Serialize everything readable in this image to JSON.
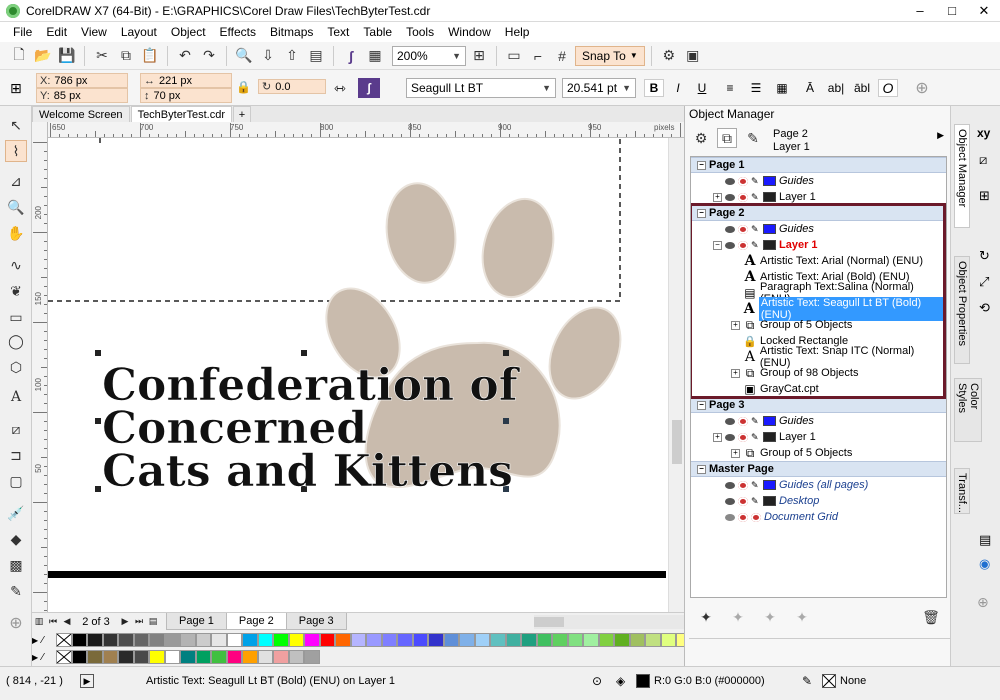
{
  "window": {
    "title": "CorelDRAW X7 (64-Bit) - E:\\GRAPHICS\\Corel Draw Files\\TechByterTest.cdr",
    "controls": [
      "–",
      "□",
      "✕"
    ]
  },
  "menu": [
    "File",
    "Edit",
    "View",
    "Layout",
    "Object",
    "Effects",
    "Bitmaps",
    "Text",
    "Table",
    "Tools",
    "Window",
    "Help"
  ],
  "toolbar": {
    "zoom": "200%",
    "snap_label": "Snap To"
  },
  "property_bar": {
    "x_label": "X:",
    "x_value": "786 px",
    "y_label": "Y:",
    "y_value": "85 px",
    "width_value": "221 px",
    "height_value": "70 px",
    "rotation_value": "0.0",
    "font_name": "Seagull Lt BT",
    "font_size": "20.541 pt",
    "font_style_glyph": "O"
  },
  "doc_tabs": [
    "Welcome Screen",
    "TechByterTest.cdr"
  ],
  "ruler": {
    "h_labels": [
      "650",
      "700",
      "750",
      "800",
      "850",
      "900",
      "950"
    ],
    "h_unit": "pixels",
    "v_labels": [
      "250",
      "200",
      "150",
      "100",
      "50"
    ]
  },
  "canvas": {
    "lines": [
      "Confederation of",
      "Concerned",
      "Cats and Kittens"
    ],
    "paw_color": "#c9bbad"
  },
  "page_nav": {
    "counter": "2 of 3",
    "tabs": [
      "Page 1",
      "Page 2",
      "Page 3"
    ],
    "active": "Page 2"
  },
  "palette": {
    "row1": [
      "#000000",
      "#1a1a1a",
      "#333333",
      "#4d4d4d",
      "#666666",
      "#808080",
      "#999999",
      "#b3b3b3",
      "#cccccc",
      "#e6e6e6",
      "#ffffff",
      "#00a2e8",
      "#00ffff",
      "#00ff00",
      "#ffff00",
      "#ff00ff",
      "#ff0000",
      "#ff6600",
      "#b5b5ff",
      "#9999ff",
      "#7f7fff",
      "#6666ff",
      "#4c4cff",
      "#3333cc",
      "#5f8fd8",
      "#7fb0e8",
      "#9fd0f8",
      "#60c0c0",
      "#40b0a0",
      "#20a080",
      "#40c060",
      "#60d060",
      "#80e080",
      "#a0f0a0",
      "#80d040",
      "#60b020",
      "#a0c060",
      "#c0e080",
      "#e0ff80",
      "#ffff80",
      "#ffe060",
      "#ffc040",
      "#ffa040",
      "#ff8040",
      "#ff6080",
      "#ff40a0",
      "#e040c0",
      "#c040e0",
      "#a060ff",
      "#8080ff"
    ],
    "row2": [
      "#000000",
      "#7a6a3a",
      "#a08050",
      "#2a2a2a",
      "#4a4a4a",
      "#ffff00",
      "#ffffff",
      "#008080",
      "#00a060",
      "#40c040",
      "#ff0080",
      "#ffa000",
      "#e0e0e0",
      "#f0a0a0",
      "#c0c0c0",
      "#a0a0a0"
    ]
  },
  "status": {
    "cursor": "( 814 , -21 )",
    "message": "Artistic Text: Seagull Lt BT (Bold) (ENU) on Layer 1",
    "fill_text": "R:0 G:0 B:0 (#000000)",
    "outline_text": "None"
  },
  "object_manager": {
    "title": "Object Manager",
    "header_page": "Page 2",
    "header_layer": "Layer 1",
    "rows": [
      {
        "label": "Page 1",
        "type": "page"
      },
      {
        "label": "Guides",
        "type": "guides",
        "color": "#1a1aff"
      },
      {
        "label": "Layer 1",
        "type": "layer",
        "color": "#222222"
      },
      {
        "label": "Page 2",
        "type": "page"
      },
      {
        "label": "Guides",
        "type": "guides",
        "color": "#1a1aff"
      },
      {
        "label": "Layer 1",
        "type": "layer-active",
        "color": "#222222"
      },
      {
        "label": "Artistic Text: Arial (Normal) (ENU)",
        "type": "text"
      },
      {
        "label": "Artistic Text: Arial (Bold) (ENU)",
        "type": "text"
      },
      {
        "label": "Paragraph Text:Salina (Normal) (ENU)",
        "type": "para"
      },
      {
        "label": "Artistic Text: Seagull Lt BT (Bold) (ENU)",
        "type": "text-selected"
      },
      {
        "label": "Group of 5 Objects",
        "type": "group"
      },
      {
        "label": "Locked Rectangle",
        "type": "lock"
      },
      {
        "label": "Artistic Text: Snap ITC (Normal) (ENU)",
        "type": "text-red"
      },
      {
        "label": "Group of 98 Objects",
        "type": "group"
      },
      {
        "label": "GrayCat.cpt",
        "type": "bitmap"
      },
      {
        "label": "Page 3",
        "type": "page"
      },
      {
        "label": "Guides",
        "type": "guides",
        "color": "#1a1aff"
      },
      {
        "label": "Layer 1",
        "type": "layer",
        "color": "#222222"
      },
      {
        "label": "Group of 5 Objects",
        "type": "group"
      },
      {
        "label": "Master Page",
        "type": "page"
      },
      {
        "label": "Guides (all pages)",
        "type": "master-guides",
        "color": "#1a1aff"
      },
      {
        "label": "Desktop",
        "type": "master-desktop",
        "color": "#222222"
      },
      {
        "label": "Document Grid",
        "type": "master-grid"
      }
    ]
  },
  "right_tabs": [
    "Object Manager",
    "Object Properties",
    "Color Styles",
    "Transf..."
  ]
}
